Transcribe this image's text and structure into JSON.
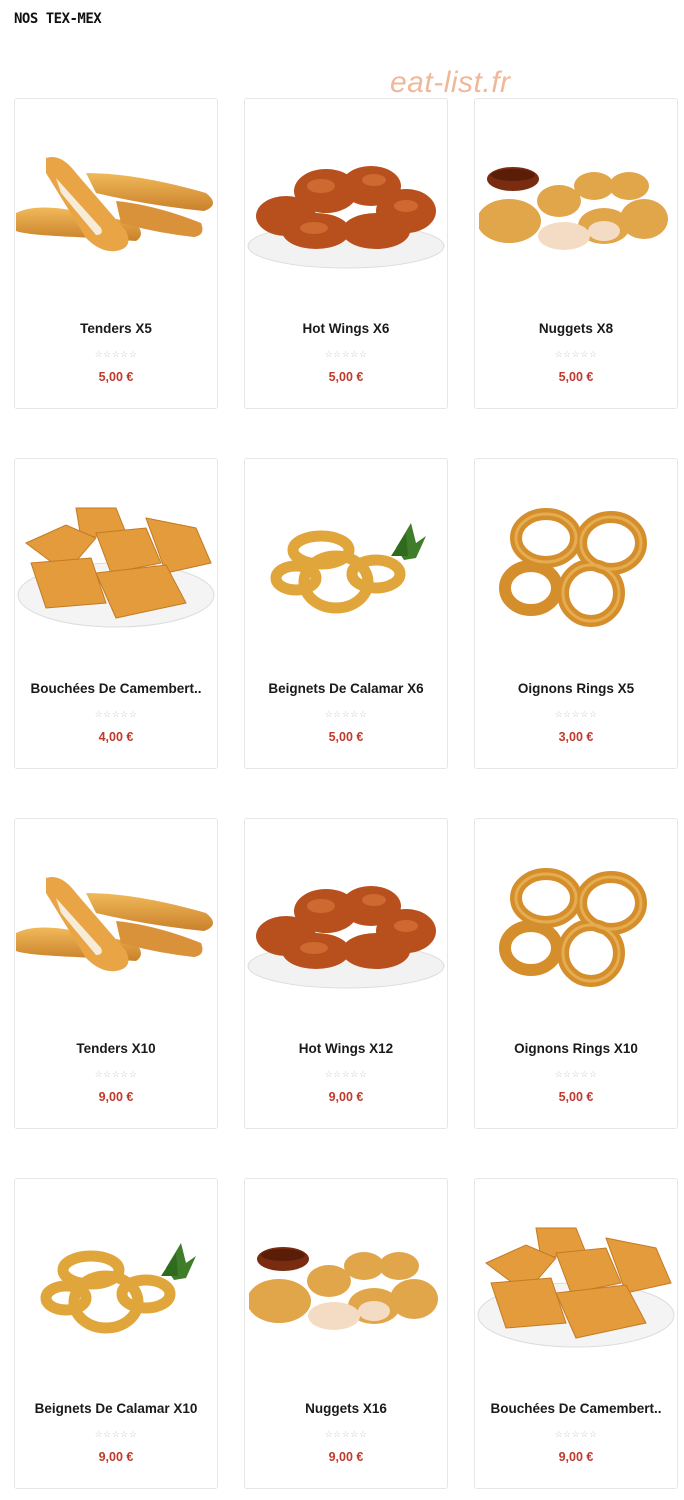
{
  "page": {
    "title": "NOS TEX-MEX",
    "watermark": "eat-list.fr"
  },
  "colors": {
    "price": "#c0392b",
    "stars": "#c9c9c9",
    "card_border": "#e6e6e6"
  },
  "rating_glyphs": "☆☆☆☆☆",
  "products": [
    {
      "name": "Tenders X5",
      "price": "5,00 €",
      "image": "tenders-image"
    },
    {
      "name": "Hot Wings X6",
      "price": "5,00 €",
      "image": "hot-wings-image"
    },
    {
      "name": "Nuggets X8",
      "price": "5,00 €",
      "image": "nuggets-image"
    },
    {
      "name": "Bouchées De Camembert..",
      "price": "4,00 €",
      "image": "camembert-image"
    },
    {
      "name": "Beignets De Calamar X6",
      "price": "5,00 €",
      "image": "calamar-image"
    },
    {
      "name": "Oignons Rings X5",
      "price": "3,00 €",
      "image": "onion-rings-image"
    },
    {
      "name": "Tenders X10",
      "price": "9,00 €",
      "image": "tenders-image"
    },
    {
      "name": "Hot Wings X12",
      "price": "9,00 €",
      "image": "hot-wings-image"
    },
    {
      "name": "Oignons Rings X10",
      "price": "5,00 €",
      "image": "onion-rings-image"
    },
    {
      "name": "Beignets De Calamar X10",
      "price": "9,00 €",
      "image": "calamar-image"
    },
    {
      "name": "Nuggets X16",
      "price": "9,00 €",
      "image": "nuggets-image"
    },
    {
      "name": "Bouchées De Camembert..",
      "price": "9,00 €",
      "image": "camembert-image"
    }
  ]
}
